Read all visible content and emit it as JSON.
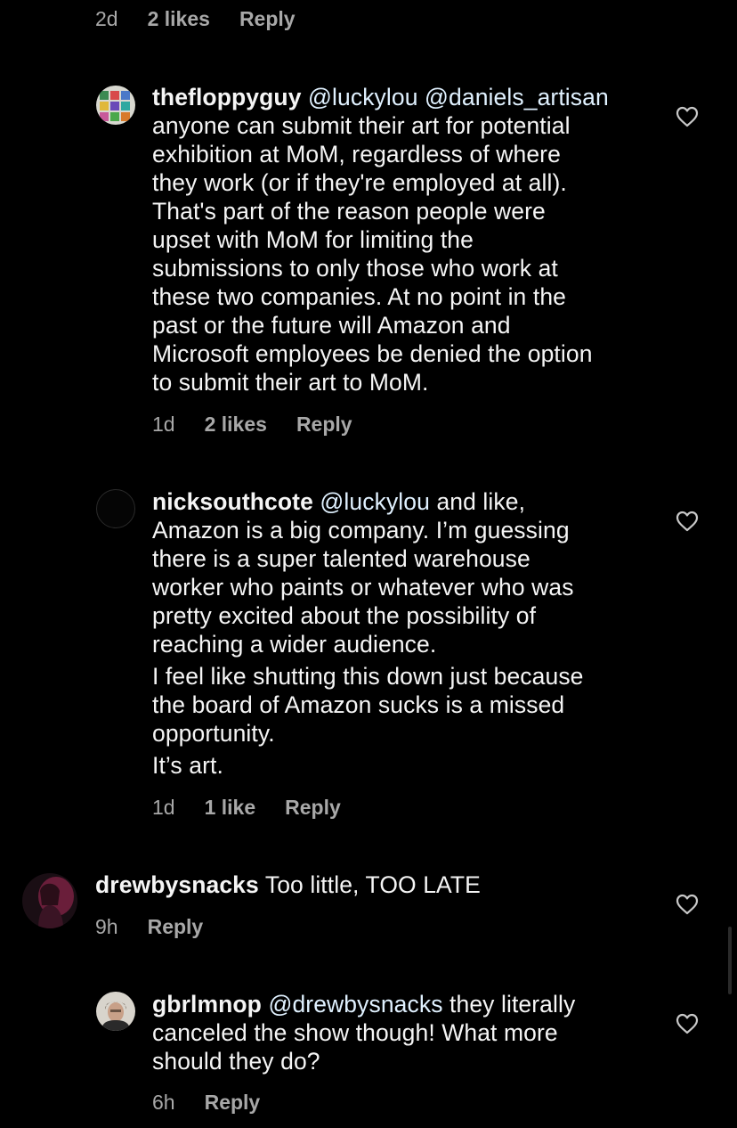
{
  "top_meta": {
    "time": "2d",
    "likes": "2 likes",
    "reply": "Reply"
  },
  "comments": [
    {
      "username": "thefloppyguy",
      "mentions": [
        "@luckylou",
        "@daniels_artisan"
      ],
      "text_lines": [
        "anyone can submit their art for potential",
        "exhibition at MoM, regardless of where",
        "they work (or if they're employed at all).",
        "That's part of the reason people were",
        "upset with MoM for limiting the",
        "submissions to only those who work at",
        "these two companies. At no point in the",
        "past or the future will Amazon and",
        "Microsoft employees be denied the option",
        "to submit their art to MoM."
      ],
      "time": "1d",
      "likes": "2 likes",
      "reply": "Reply",
      "icon": "heart-outline-icon"
    },
    {
      "username": "nicksouthcote",
      "mention": "@luckylou",
      "first_text": "and like,",
      "paragraph1": [
        "Amazon is a big company. I’m guessing",
        "there is a super talented warehouse",
        "worker who paints or whatever who was",
        "pretty excited about the possibility of",
        "reaching a wider audience."
      ],
      "paragraph2": [
        "I feel like shutting this down just because",
        "the board of Amazon sucks is a missed",
        "opportunity."
      ],
      "paragraph3": "It’s art.",
      "time": "1d",
      "likes": "1 like",
      "reply": "Reply",
      "icon": "heart-outline-icon"
    },
    {
      "username": "drewbysnacks",
      "text": "Too little, TOO LATE",
      "time": "9h",
      "reply": "Reply",
      "icon": "heart-outline-icon"
    },
    {
      "username": "gbrlmnop",
      "mention": "@drewbysnacks",
      "first_text": "they literally",
      "text_lines": [
        "canceled the show though! What more",
        "should they do?"
      ],
      "time": "6h",
      "reply": "Reply",
      "icon": "heart-outline-icon"
    }
  ],
  "colors": {
    "background": "#000000",
    "text": "#f5f5f5",
    "meta": "#a8a8a8",
    "mention": "#e0f1ff"
  }
}
